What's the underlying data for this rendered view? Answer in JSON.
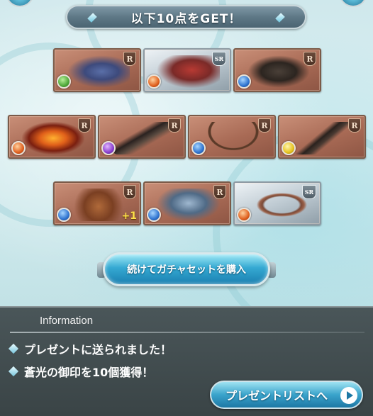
{
  "banner": {
    "text": "以下10点をGET！"
  },
  "cards": [
    {
      "rarity": "R",
      "element": "wind",
      "color": "#4fa83a",
      "art": "dragon"
    },
    {
      "rarity": "SR",
      "element": "fire",
      "color": "#e0611f",
      "art": "beast"
    },
    {
      "rarity": "R",
      "element": "water",
      "color": "#2f74d0",
      "art": "gauntlet"
    },
    {
      "rarity": "R",
      "element": "fire",
      "color": "#e0611f",
      "art": "flame-spirit"
    },
    {
      "rarity": "R",
      "element": "dark",
      "color": "#8a3fcf",
      "art": "blade"
    },
    {
      "rarity": "R",
      "element": "water",
      "color": "#2f74d0",
      "art": "bow"
    },
    {
      "rarity": "R",
      "element": "light",
      "color": "#e6c21e",
      "art": "axe"
    },
    {
      "rarity": "R",
      "element": "water",
      "color": "#2f74d0",
      "art": "pot-creature",
      "plus": "+1"
    },
    {
      "rarity": "R",
      "element": "water",
      "color": "#2f74d0",
      "art": "undead-knight"
    },
    {
      "rarity": "SR",
      "element": "fire",
      "color": "#e0611f",
      "art": "harp"
    }
  ],
  "actions": {
    "buy_label": "続けてガチャセットを購入"
  },
  "information": {
    "title": "Information",
    "messages": [
      "プレゼントに送られました！",
      "蒼光の御印を10個獲得！"
    ]
  },
  "present_list": {
    "label": "プレゼントリストへ"
  }
}
